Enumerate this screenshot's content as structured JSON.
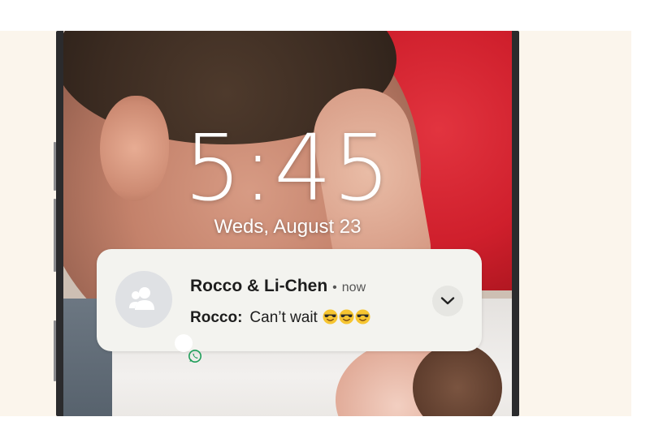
{
  "lockscreen": {
    "time": "5:45",
    "date": "Weds, August 23"
  },
  "notification": {
    "title": "Rocco & Li-Chen",
    "separator": "•",
    "timestamp": "now",
    "sender": "Rocco:",
    "message": "Can’t wait",
    "emojis": [
      "smiling-face-with-sunglasses",
      "smiling-face-with-sunglasses",
      "smiling-face-with-sunglasses"
    ],
    "app_icon": "whatsapp-icon",
    "avatar_icon": "group-icon",
    "expand_icon": "chevron-down-icon"
  },
  "colors": {
    "card_bg": "#f3f3ef",
    "whatsapp_green": "#1f9e5a",
    "emoji_yellow": "#f6c531"
  }
}
